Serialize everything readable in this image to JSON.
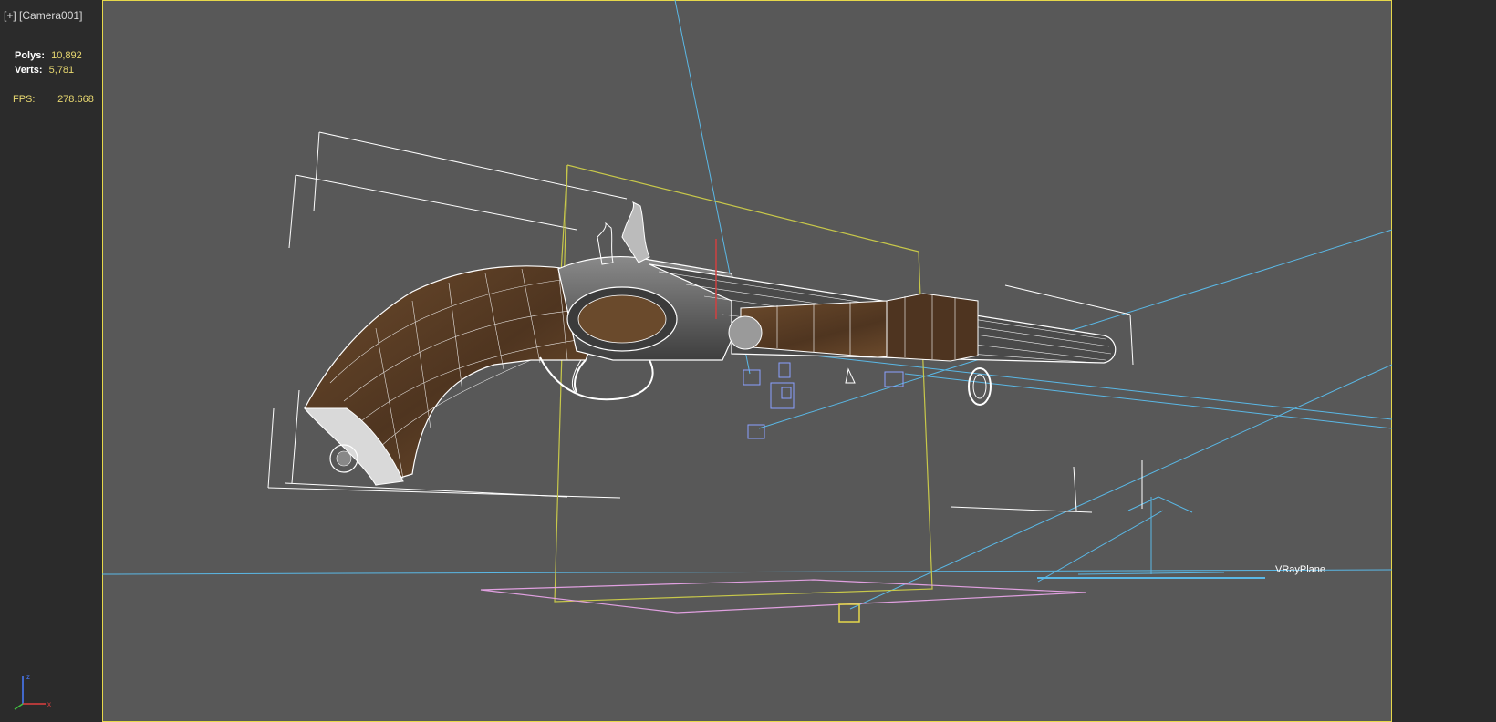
{
  "viewport": {
    "menu_plus": "[+]",
    "camera_label": "[Camera001]"
  },
  "stats": {
    "polys_label": "Polys:",
    "polys_value": "10,892",
    "verts_label": "Verts:",
    "verts_value": "5,781",
    "fps_label": "FPS:",
    "fps_value": "278.668"
  },
  "scene": {
    "plane_label": "VRayPlane"
  },
  "gizmo": {
    "x_label": "x",
    "z_label": "z"
  },
  "colors": {
    "viewport_bg": "#585858",
    "panel_bg": "#2b2b2b",
    "active_border": "#e6d84a",
    "stat_value": "#e8d870",
    "light_line": "#5ab8e6",
    "wire": "#ffffff",
    "camera_frame": "#c8c84a",
    "ground_plane": "#e0a0e0",
    "wood": "#5a3d24"
  }
}
